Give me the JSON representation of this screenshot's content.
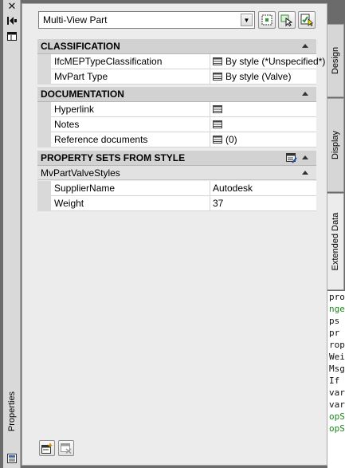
{
  "palette": {
    "header": "Properties"
  },
  "selector": {
    "value": "Multi-View Part"
  },
  "toolbar": {
    "icons": [
      "quick-select-icon",
      "select-objects-icon",
      "toggle-pickadd-icon"
    ]
  },
  "categories": [
    {
      "title": "CLASSIFICATION",
      "rows": [
        {
          "name": "IfcMEPTypeClassification",
          "value": "By style (*Unspecified*)"
        },
        {
          "name": "MvPart Type",
          "value": "By style (Valve)"
        }
      ]
    },
    {
      "title": "DOCUMENTATION",
      "rows": [
        {
          "name": "Hyperlink",
          "value": ""
        },
        {
          "name": "Notes",
          "value": ""
        },
        {
          "name": "Reference documents",
          "value": "(0)"
        }
      ]
    },
    {
      "title": "PROPERTY SETS FROM STYLE",
      "subgroup": "MvPartValveStyles",
      "rows": [
        {
          "name": "SupplierName",
          "value": "Autodesk"
        },
        {
          "name": "Weight",
          "value": "37"
        }
      ]
    }
  ],
  "tabs": [
    "Design",
    "Display",
    "Extended Data"
  ],
  "background_code": [
    "pro",
    "nge",
    "ps",
    "",
    " pr",
    "rop",
    "Wei",
    "Msg",
    "If",
    "",
    "var",
    "var",
    "opS",
    "opSe"
  ]
}
